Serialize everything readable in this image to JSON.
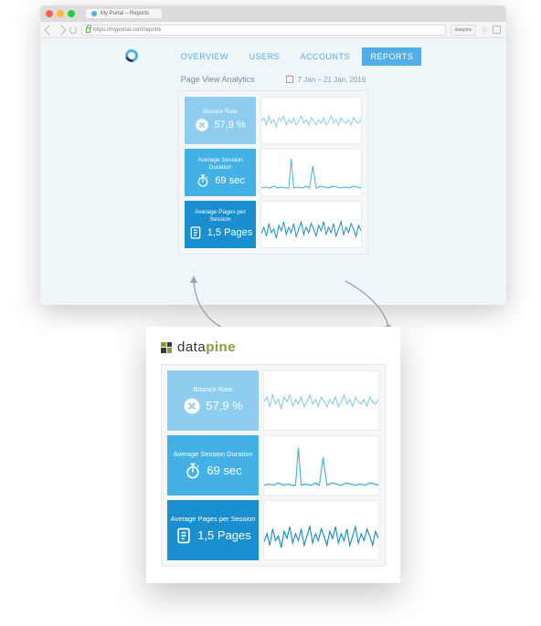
{
  "browser": {
    "tab_title": "My Portal – Reports",
    "url": "https://myportal.com/reports",
    "extension_label": "datapine"
  },
  "nav": {
    "items": [
      "OVERVIEW",
      "USERS",
      "ACCOUNTS",
      "REPORTS"
    ],
    "active_index": 3
  },
  "subheader": {
    "title": "Page View Analytics",
    "date_range": "7 Jan – 21 Jan, 2016"
  },
  "metrics": [
    {
      "label": "Bounce Rate",
      "value": "57,9 %",
      "icon": "x-circle",
      "color": "#8fcdf0"
    },
    {
      "label": "Average Session Duration",
      "value": "69 sec",
      "icon": "stopwatch",
      "color": "#43b0e6"
    },
    {
      "label": "Average Pages per Session",
      "value": "1,5 Pages",
      "icon": "document",
      "color": "#1a8fd0"
    }
  ],
  "panel": {
    "brand_prefix": "data",
    "brand_suffix": "pine"
  },
  "colors": {
    "spark": "#52aee6"
  }
}
